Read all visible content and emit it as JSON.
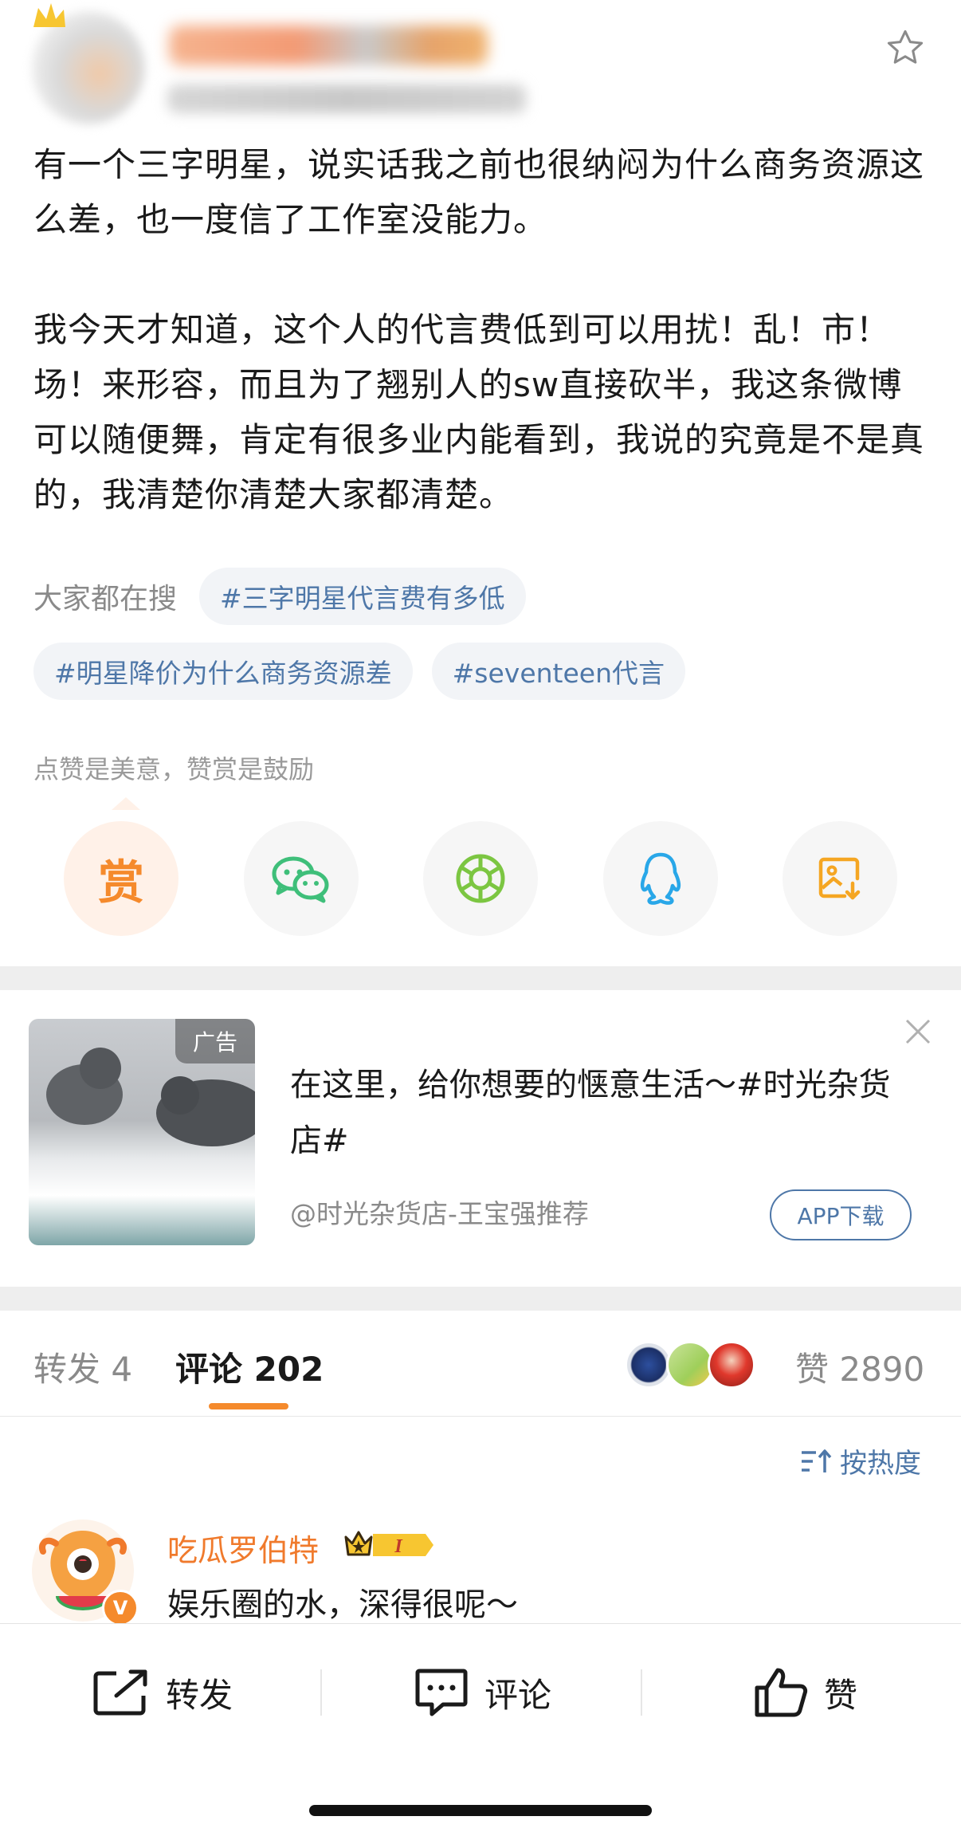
{
  "post": {
    "paragraph1": "有一个三字明星，说实话我之前也很纳闷为什么商务资源这么差，也一度信了工作室没能力。",
    "paragraph2": "我今天才知道，这个人的代言费低到可以用扰！乱！市！场！来形容，而且为了翘别人的sw直接砍半，我这条微博可以随便舞，肯定有很多业内能看到，我说的究竟是不是真的，我清楚你清楚大家都清楚。"
  },
  "tags": {
    "label": "大家都在搜",
    "items": [
      "#三字明星代言费有多低",
      "#明星降价为什么商务资源差",
      "#seventeen代言"
    ]
  },
  "reward": {
    "hint": "点赞是美意，赞赏是鼓励",
    "glyph": "赏"
  },
  "share_icons": [
    "reward-icon",
    "wechat-icon",
    "moments-icon",
    "qq-icon",
    "save-image-icon"
  ],
  "ad": {
    "badge": "广告",
    "title": "在这里，给你想要的惬意生活～#时光杂货店#",
    "source": "@时光杂货店-王宝强推荐",
    "button": "APP下载"
  },
  "tabs": {
    "repost": "转发 4",
    "comments": "评论 202",
    "likes": "赞 2890"
  },
  "sort": {
    "label": "按热度"
  },
  "comment": {
    "username": "吃瓜罗伯特",
    "level": "I",
    "text": "娱乐圈的水，深得很呢～",
    "verified_badge": "V"
  },
  "bottom_bar": {
    "repost": "转发",
    "comment": "评论",
    "like": "赞"
  },
  "colors": {
    "accent_orange": "#f58a2c",
    "link_blue": "#4e77a8",
    "text_gray": "#8a8a8a"
  }
}
